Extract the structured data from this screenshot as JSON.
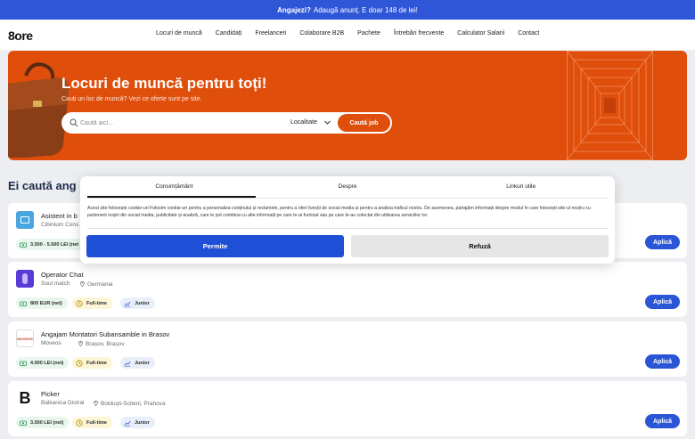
{
  "banner": {
    "bold": "Angajezi?",
    "text": "Adaugă anunț. E doar 148 de lei!"
  },
  "header": {
    "logo_num": "8",
    "logo_text": "ore",
    "menu": [
      "Locuri de muncă",
      "Candidați",
      "Freelanceri",
      "Colaborare B2B",
      "Pachete",
      "Întrebări frecvente",
      "Calculator Salarii",
      "Contact"
    ]
  },
  "hero": {
    "title": "Locuri de muncă pentru toți!",
    "subtitle": "Cauți un loc de muncă? Vezi ce oferte sunt pe site.",
    "search_placeholder": "Caută aici...",
    "location_label": "Localitate",
    "search_button": "Caută job"
  },
  "section": {
    "title": "Ei caută ang"
  },
  "jobs": [
    {
      "title": "Asistent in b",
      "company": "Cibinium Cons",
      "location": "",
      "salary": "3.500 - 5.500 LEI (net",
      "type": "",
      "level": "",
      "apply": "Aplică",
      "logo_color": "#4aa6e0"
    },
    {
      "title": "Operator Chat",
      "company": "Soul match",
      "location": "Germania",
      "salary": "800 EUR (net)",
      "type": "Full-time",
      "level": "Junior",
      "apply": "Aplică",
      "logo_color": "#5a3ad6"
    },
    {
      "title": "Angajam Montatori Subansamble in Brasov",
      "company": "Moveos",
      "location": "Brașov, Brașov",
      "salary": "4.000 LEI (net)",
      "type": "Full-time",
      "level": "Junior",
      "apply": "Aplică",
      "logo_color": "#c0392b"
    },
    {
      "title": "Picker",
      "company": "Balkanica Distral",
      "location": "Bolduști-Sciteni, Prahova",
      "salary": "3.500 LEI (net)",
      "type": "Full-time",
      "level": "Junior",
      "apply": "Aplică",
      "logo_color": "#111111"
    }
  ],
  "cookie": {
    "tabs": [
      "Consimțământ",
      "Despre",
      "Linkuri utile"
    ],
    "text": "Acest site folosește cookie-uri Folosim cookie-uri pentru a personaliza conținutul și reclamele, pentru a oferi funcții de social media și pentru a analiza traficul nostru. De asemenea, partajăm informații despre modul în care folosești site-ul nostru cu partenerii noștri din social media, publicitate și analiză, care le pot combina cu alte informații pe care le-ai furnizat sau pe care le-au colectat din utilizarea serviciilor lor.",
    "allow": "Permite",
    "refuse": "Refuză"
  },
  "colors": {
    "brand_orange": "#e04e0c",
    "primary_blue": "#2a56d6"
  }
}
